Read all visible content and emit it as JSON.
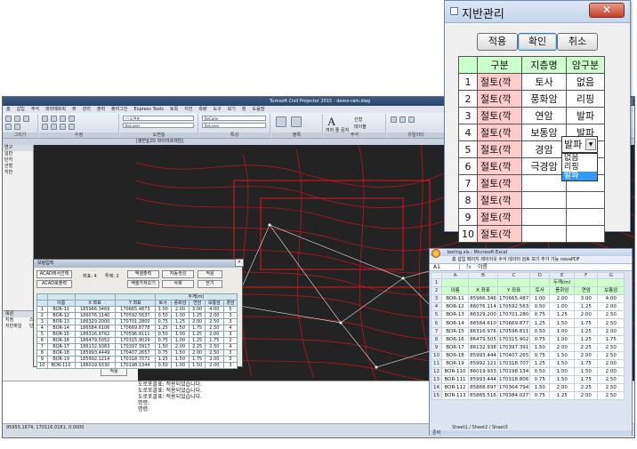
{
  "cad": {
    "title": "Turnsoft Civil Projector 2015 - demo-rain.dwg",
    "menu": [
      "홈",
      "삽입",
      "주석",
      "파라메트릭",
      "뷰",
      "관리",
      "출력",
      "플러그인",
      "Express Tools",
      "토목",
      "지반",
      "측량",
      "도구",
      "보기",
      "창",
      "도움말"
    ],
    "ribbon": {
      "groups": [
        "그리기",
        "수정",
        "도면층",
        "특성",
        "블록",
        "주석",
        "유틸리티"
      ],
      "combos": [
        "□ 도면층",
        "ByLayer",
        "ByLayer",
        "ByLayer",
        "ByColor"
      ],
      "text_button": "여러 줄 문자",
      "line_label": "선형",
      "table_label": "테이블"
    },
    "tab_strip": "모형 배치1 배치2",
    "viewport_label": "[평면][2D 와이어프레임]",
    "side": {
      "header": "연구",
      "items": [
        "일반",
        "단지",
        "선형",
        "지반"
      ]
    },
    "props": {
      "header": "폭원",
      "rows": [
        [
          "지정",
          "스타일"
        ],
        [
          "지반파일",
          "단지(대)"
        ]
      ]
    },
    "cmdline": {
      "lines": [
        "도로포괄표: 적용되었습니다.",
        "도로포괄표: 적용되었습니다.",
        "도로포괄표: 적용되었습니다.",
        "명령:",
        "명령:"
      ],
      "ok_button": "적용"
    },
    "status": "95955.1674, 170116.0181, 0.0000"
  },
  "boring_dialog": {
    "title": "보링입력",
    "btn_acad_select": "ACAD에서선택",
    "btn_acad_output": "ACAD로출력",
    "label_list": "좌표: 4",
    "label_count": "투께: 2",
    "btn_excel_out": "엑셀출력",
    "btn_excel_in": "엑셀가져오기",
    "btn_auto_create": "자동생성",
    "btn_delete": "삭제",
    "btn_apply": "적용",
    "btn_close": "닫기",
    "header_top": "두께(m)",
    "columns": [
      "",
      "이름",
      "X 좌표",
      "Y 좌표",
      "토사",
      "풍화암",
      "연암",
      "보통암",
      "경암"
    ],
    "rows": [
      [
        "1",
        "BOR-11",
        "185966.3469",
        "170665.4873",
        "1.00",
        "2.00",
        "3.00",
        "4.00",
        "5"
      ],
      [
        "2",
        "BOR-12",
        "186076.1140",
        "170592.5637",
        "0.50",
        "1.00",
        "1.25",
        "2.00",
        "3"
      ],
      [
        "3",
        "BOR-13",
        "186329.2000",
        "170701.2800",
        "0.75",
        "1.25",
        "2.00",
        "2.50",
        "3"
      ],
      [
        "4",
        "BOR-14",
        "186584.6106",
        "170669.8778",
        "1.25",
        "1.50",
        "1.75",
        "2.50",
        "4"
      ],
      [
        "5",
        "BOR-15",
        "186316.9762",
        "170596.8111",
        "0.50",
        "1.00",
        "1.25",
        "2.00",
        "3"
      ],
      [
        "6",
        "BOR-16",
        "186479.5052",
        "170315.9029",
        "0.75",
        "1.00",
        "1.25",
        "1.75",
        "2"
      ],
      [
        "7",
        "BOR-17",
        "186132.9383",
        "170397.3917",
        "1.50",
        "2.00",
        "2.25",
        "2.50",
        "4"
      ],
      [
        "8",
        "BOR-18",
        "185993.4449",
        "170407.2657",
        "0.75",
        "1.50",
        "2.00",
        "2.50",
        "3"
      ],
      [
        "9",
        "BOR-19",
        "185992.1214",
        "170318.7071",
        "1.25",
        "1.50",
        "1.75",
        "2.00",
        "3"
      ],
      [
        "10",
        "BOR-110",
        "186019.9330",
        "170198.1344",
        "0.50",
        "1.00",
        "1.50",
        "2.00",
        "3"
      ]
    ]
  },
  "ground_dialog": {
    "title": "지반관리",
    "btn_apply": "적용",
    "btn_ok": "확인",
    "btn_cancel": "취소",
    "columns": [
      "",
      "구분",
      "지층명",
      "암구분"
    ],
    "rows": [
      [
        "1",
        "절토(깍",
        "토사",
        "없음"
      ],
      [
        "2",
        "절토(깍",
        "풍화암",
        "리핑"
      ],
      [
        "3",
        "절토(깍",
        "연암",
        "발파"
      ],
      [
        "4",
        "절토(깍",
        "보통암",
        "발파"
      ],
      [
        "5",
        "절토(깍",
        "경암",
        "발파"
      ],
      [
        "6",
        "절토(깍",
        "극경암",
        "발파"
      ],
      [
        "7",
        "절토(깍",
        "",
        ""
      ],
      [
        "8",
        "절토(깍",
        "",
        ""
      ],
      [
        "9",
        "절토(깍",
        "",
        ""
      ],
      [
        "10",
        "절토(깍",
        "",
        ""
      ]
    ],
    "dropdown": {
      "value": "발파",
      "options": [
        "없음",
        "리핑",
        "발파"
      ],
      "selected_index": 2
    }
  },
  "excel": {
    "title": "boring.xls - Microsoft Excel",
    "menu": "홈  삽입  페이지 레이아웃  수식  데이터  검토  보기  추가 기능  novaPDF",
    "cell_ref": "A1",
    "formula": "이름",
    "col_letters": [
      "",
      "A",
      "B",
      "C",
      "D",
      "E",
      "F",
      "G"
    ],
    "header1": [
      "1",
      "",
      "",
      "",
      "",
      "두께(m)",
      "",
      ""
    ],
    "header2": [
      "2",
      "이름",
      "X 좌표",
      "Y 좌표",
      "토사",
      "풍화암",
      "연암",
      "보통암"
    ],
    "rows": [
      [
        "3",
        "BOR-11",
        "85966.346",
        "170665.487",
        "1.00",
        "2.00",
        "3.00",
        "4.00"
      ],
      [
        "4",
        "BOR-12",
        "86076.114",
        "170592.563",
        "0.50",
        "1.00",
        "1.25",
        "2.00"
      ],
      [
        "5",
        "BOR-13",
        "86329.200",
        "170701.280",
        "0.75",
        "1.25",
        "2.00",
        "2.50"
      ],
      [
        "6",
        "BOR-14",
        "86584.610",
        "170669.877",
        "1.25",
        "1.50",
        "1.75",
        "2.50"
      ],
      [
        "7",
        "BOR-15",
        "86316.976",
        "170596.811",
        "0.50",
        "1.00",
        "1.25",
        "2.00"
      ],
      [
        "8",
        "BOR-16",
        "86479.505",
        "170315.902",
        "0.75",
        "1.00",
        "1.25",
        "1.75"
      ],
      [
        "9",
        "BOR-17",
        "86132.938",
        "170397.391",
        "1.50",
        "2.00",
        "2.25",
        "2.50"
      ],
      [
        "10",
        "BOR-18",
        "85993.444",
        "170407.265",
        "0.75",
        "1.50",
        "2.00",
        "2.50"
      ],
      [
        "11",
        "BOR-19",
        "85992.121",
        "170318.707",
        "1.25",
        "1.50",
        "1.75",
        "2.00"
      ],
      [
        "12",
        "BOR-110",
        "86019.933",
        "170198.134",
        "0.50",
        "1.00",
        "1.50",
        "2.00"
      ],
      [
        "13",
        "BOR-111",
        "85993.444",
        "170318.806",
        "0.75",
        "1.50",
        "1.75",
        "2.50"
      ],
      [
        "14",
        "BOR-112",
        "85868.697",
        "170364.794",
        "1.50",
        "2.00",
        "2.25",
        "2.50"
      ],
      [
        "15",
        "BOR-113",
        "85865.516",
        "170384.027",
        "0.75",
        "1.25",
        "2.00",
        "2.50"
      ]
    ],
    "sheets": "Sheet1 / Sheet2 / Sheet3",
    "status": "준비"
  }
}
